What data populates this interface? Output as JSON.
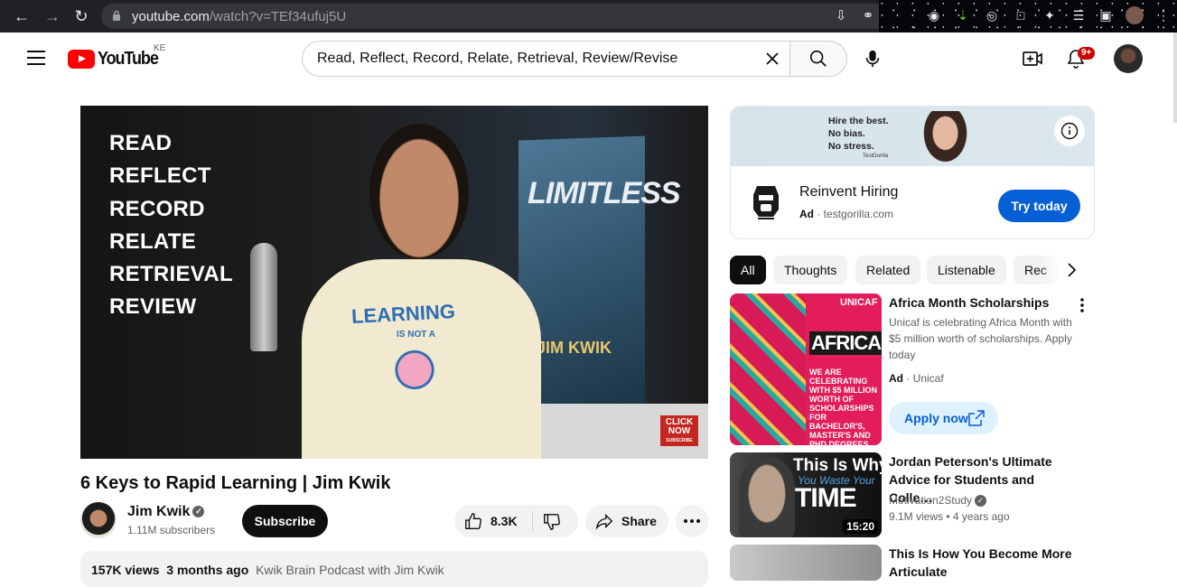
{
  "browser": {
    "url_host": "youtube.com",
    "url_path": "/watch?v=TEf34ufuj5U"
  },
  "header": {
    "logo_text": "YouTube",
    "country": "KE",
    "search_query": "Read, Reflect, Record, Relate, Retrieval, Review/Revise",
    "notification_count": "9+"
  },
  "video": {
    "overlay_words": [
      "READ",
      "REFLECT",
      "RECORD",
      "RELATE",
      "RETRIEVAL",
      "REVIEW"
    ],
    "book_title": "LIMITLESS",
    "book_author": "JIM KWIK",
    "shirt_text": "LEARNING",
    "shirt_subtext": "IS NOT A",
    "click_now": "CLICK NOW",
    "click_sub": "SUBSCRIBE",
    "title": "6 Keys to Rapid Learning | Jim Kwik",
    "channel": "Jim Kwik",
    "subscribers": "1.11M subscribers",
    "subscribe_label": "Subscribe",
    "likes": "8.3K",
    "share_label": "Share",
    "views": "157K views",
    "age": "3 months ago",
    "desc_link": "Kwik Brain Podcast with Jim Kwik"
  },
  "ad": {
    "slogan_1": "Hire the best.",
    "slogan_2": "No bias.",
    "slogan_3": "No stress.",
    "banner_brand": "TestGorilla",
    "name": "Reinvent Hiring",
    "ad_label": "Ad",
    "domain": "testgorilla.com",
    "cta": "Try today"
  },
  "chips": [
    "All",
    "Thoughts",
    "Related",
    "Listenable",
    "Rec"
  ],
  "recommendations": [
    {
      "title": "Africa Month Scholarships",
      "description": "Unicaf is celebrating Africa Month with $5 million worth of scholarships. Apply today",
      "ad_label": "Ad",
      "advertiser": "Unicaf",
      "cta": "Apply now",
      "thumb_brand": "UNICAF",
      "thumb_big": "AFRICA",
      "thumb_small": "WE ARE CELEBRATING WITH $5 MILLION WORTH OF SCHOLARSHIPS FOR BACHELOR'S, MASTER'S AND PHD DEGREES"
    },
    {
      "title": "Jordan Peterson's Ultimate Advice for Students and Colle…",
      "channel": "Motivation2Study",
      "views": "9.1M views",
      "age": "4 years ago",
      "duration": "15:20",
      "thumb_line1": "This Is Why",
      "thumb_line2": "You Waste Your",
      "thumb_line3": "TIME"
    },
    {
      "title": "This Is How You Become More Articulate"
    }
  ]
}
